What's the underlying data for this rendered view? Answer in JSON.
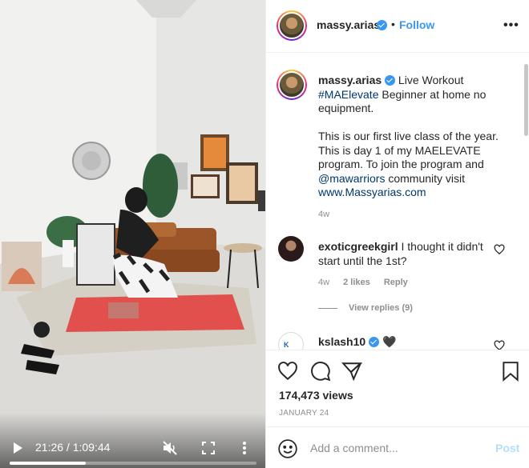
{
  "video": {
    "time_display": "21:26 / 1:09:44",
    "progress_fraction": 0.307,
    "icons": [
      "play-icon",
      "volume-muted-icon",
      "fullscreen-icon",
      "more-vertical-icon"
    ]
  },
  "header": {
    "username": "massy.arias",
    "dot": "•",
    "follow_label": "Follow",
    "more": "•••"
  },
  "caption": {
    "username": "massy.arias",
    "lead": " Live Workout ",
    "hashtag": "#MAElevate",
    "after_hashtag": " Beginner at home no equipment.",
    "paragraph2": "This is our first live class of the year. This is day 1 of my MAELEVATE program. To join the program and ",
    "mention": "@mawarriors",
    "after_mention": " community visit ",
    "url": "www.Massyarias.com",
    "age": "4w"
  },
  "comments": [
    {
      "username": "exoticgreekgirl",
      "text": " I thought it didn't start until the 1st?",
      "age": "4w",
      "likes": "2 likes",
      "reply_label": "Reply",
      "view_replies": "View replies (9)"
    },
    {
      "username": "kslash10",
      "avatar_text": "K",
      "text": " 🖤"
    }
  ],
  "actions": {
    "views": "174,473 views",
    "date": "JANUARY 24"
  },
  "add_comment": {
    "placeholder": "Add a comment...",
    "post_label": "Post"
  },
  "colors": {
    "link": "#00376b",
    "follow": "#3897f0",
    "verified": "#3897f0",
    "post_disabled": "#b2dffc"
  }
}
